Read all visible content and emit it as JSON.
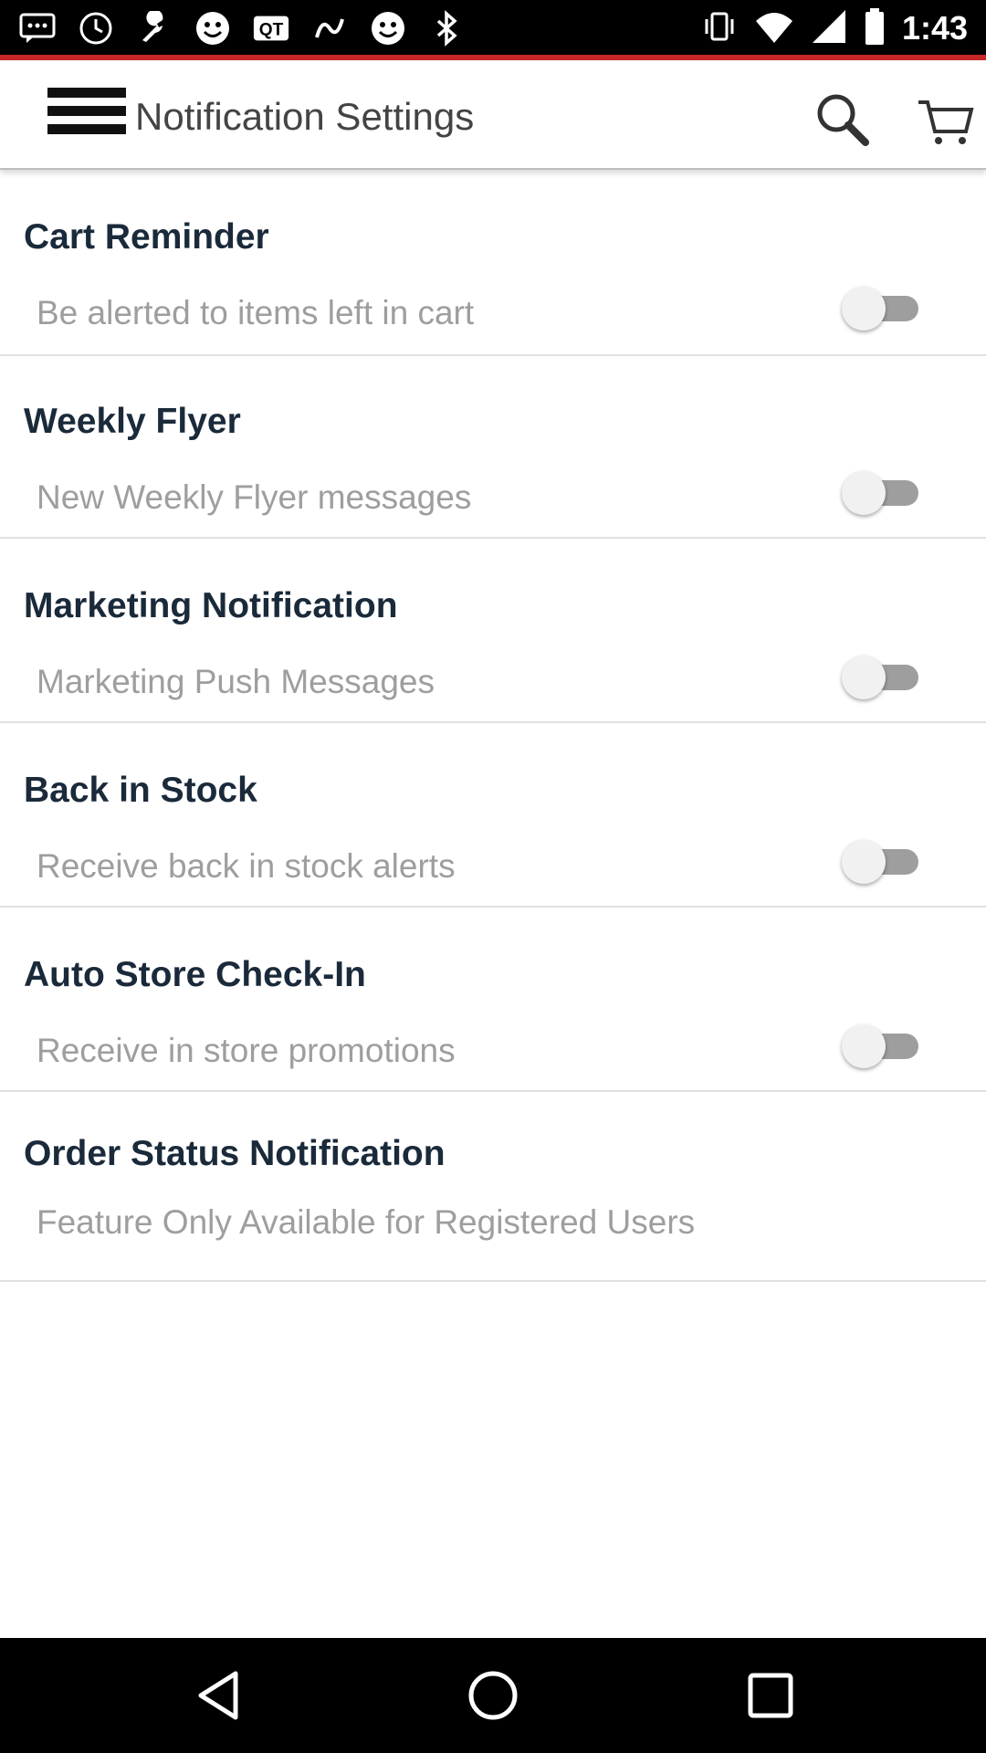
{
  "status_bar": {
    "time": "1:43",
    "left_icons": [
      "message-icon",
      "clock-icon",
      "wrench-icon",
      "smiley-icon",
      "qq-icon",
      "gesture-icon",
      "smiley-icon",
      "bluetooth-icon"
    ],
    "right_icons": [
      "vibrate-icon",
      "wifi-icon",
      "signal-icon",
      "battery-icon"
    ]
  },
  "app_bar": {
    "title": "Notification Settings",
    "icons": [
      "menu-icon",
      "search-icon",
      "cart-icon"
    ]
  },
  "settings": [
    {
      "title": "Cart Reminder",
      "description": "Be alerted to items left in cart",
      "has_toggle": true,
      "enabled": false
    },
    {
      "title": "Weekly Flyer",
      "description": "New Weekly Flyer messages",
      "has_toggle": true,
      "enabled": false
    },
    {
      "title": "Marketing Notification",
      "description": "Marketing Push Messages",
      "has_toggle": true,
      "enabled": false
    },
    {
      "title": "Back in Stock",
      "description": "Receive back in stock alerts",
      "has_toggle": true,
      "enabled": false
    },
    {
      "title": "Auto Store Check-In",
      "description": "Receive in store promotions",
      "has_toggle": true,
      "enabled": false
    },
    {
      "title": "Order Status Notification",
      "description": "Feature Only Available for Registered Users",
      "has_toggle": false
    }
  ],
  "nav_bar": {
    "buttons": [
      "back-icon",
      "home-icon",
      "recents-icon"
    ]
  },
  "colors": {
    "accent_line": "#c62828",
    "title_text": "#1a2a3a",
    "description_text": "#9e9e9e",
    "toggle_off_track": "#9e9e9e"
  }
}
